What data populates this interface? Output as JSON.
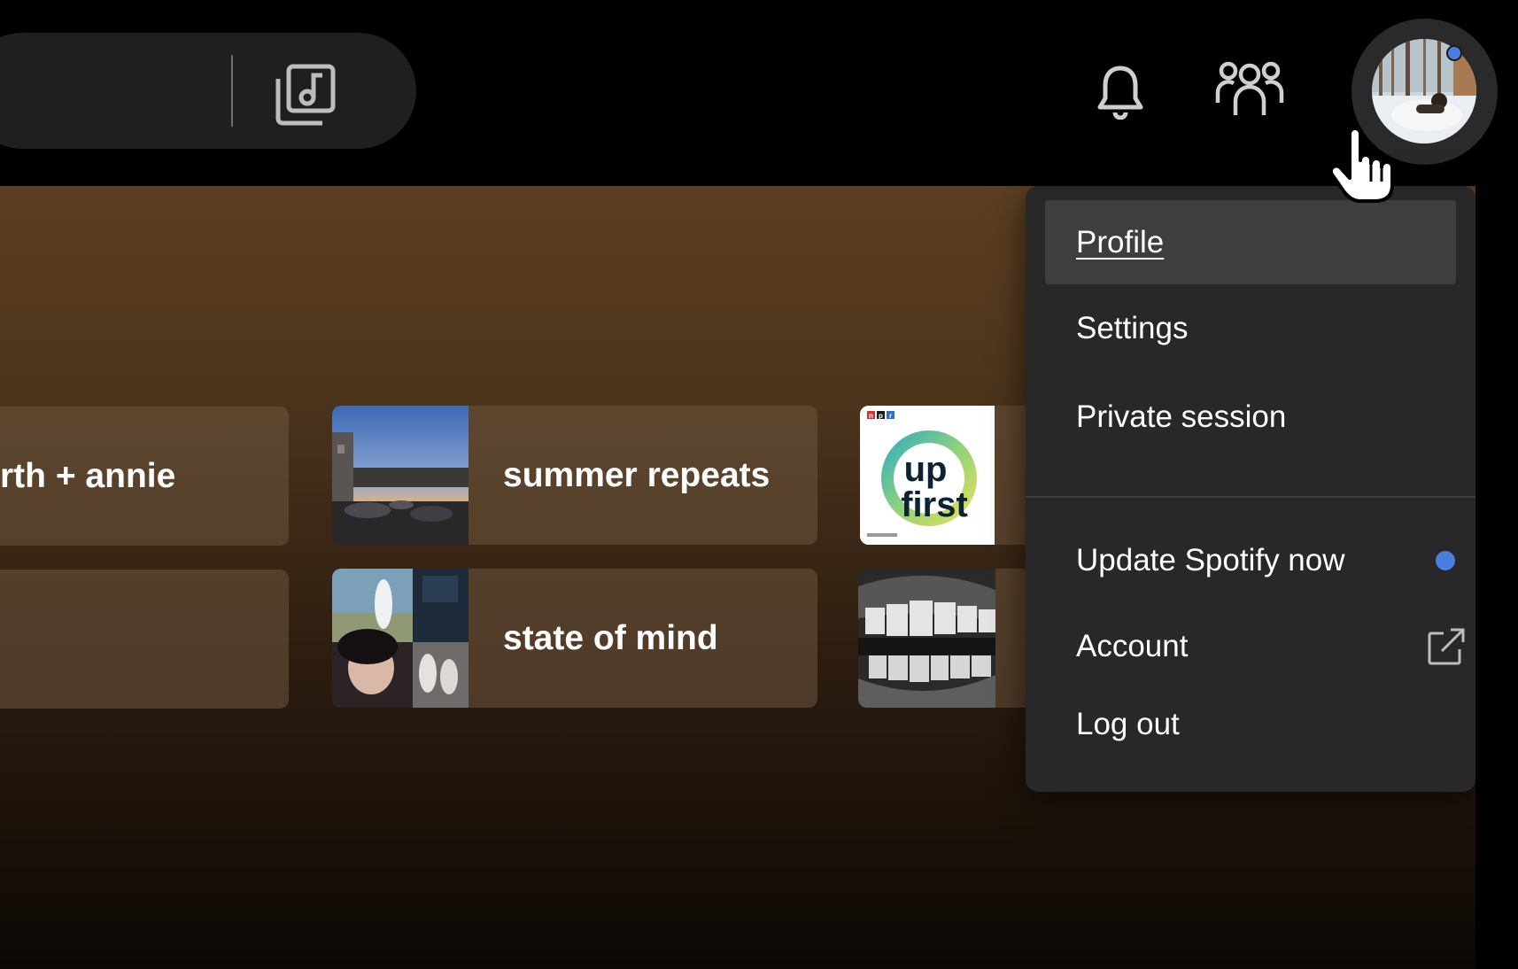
{
  "topbar": {
    "browse_icon": "library-music-icon",
    "notifications_icon": "bell-icon",
    "friends_icon": "friends-activity-icon",
    "avatar_badge_color": "#4a7fe0"
  },
  "shortcuts": [
    {
      "title": "rth + annie",
      "thumb": "none"
    },
    {
      "title": "summer repeats",
      "thumb": "sunset-street-photo"
    },
    {
      "title": "",
      "thumb": "up-first-podcast-cover"
    },
    {
      "title": "",
      "thumb": "none"
    },
    {
      "title": "state of mind",
      "thumb": "collage-photo"
    },
    {
      "title": "",
      "thumb": "teeth-photo"
    }
  ],
  "podcast_cover": {
    "badge": "n p r",
    "line1": "up",
    "line2": "first"
  },
  "profile_menu": {
    "items": [
      {
        "label": "Profile",
        "active": true
      },
      {
        "label": "Settings"
      },
      {
        "label": "Private session"
      },
      {
        "label": "Update Spotify now",
        "indicator_color": "#4a7fe0"
      },
      {
        "label": "Account",
        "icon": "external-link-icon"
      },
      {
        "label": "Log out"
      }
    ]
  },
  "colors": {
    "menu_bg": "#282828",
    "menu_active": "#3e3e3e",
    "accent_blue": "#4a7fe0",
    "gradient_top": "#5d3f22"
  }
}
